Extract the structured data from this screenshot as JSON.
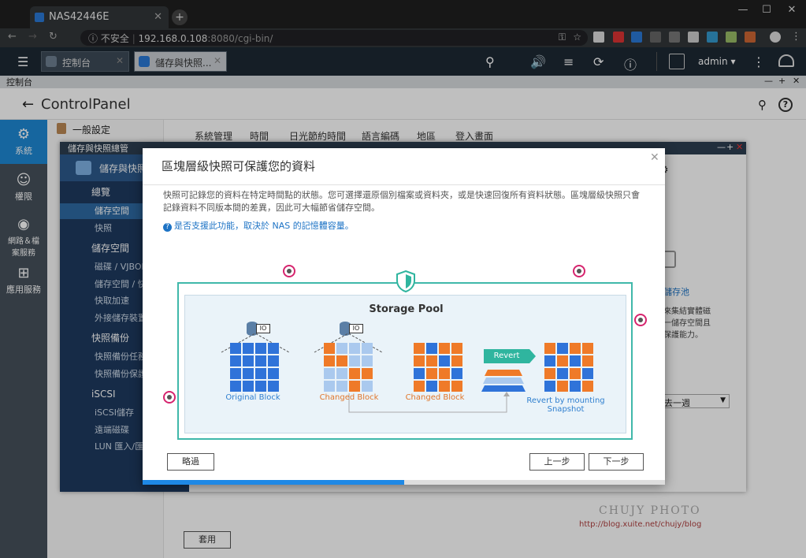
{
  "browser": {
    "tab_title": "NAS42446E",
    "tab_close": "✕",
    "new_tab": "+",
    "window_controls": [
      "—",
      "☐",
      "✕"
    ],
    "nav": [
      "←",
      "→",
      "↻"
    ],
    "security_icon": "ⓘ",
    "security_label": "不安全",
    "url_host": "192.168.0.108",
    "url_rest": ":8080/cgi-bin/",
    "key_icon": "⚿",
    "star_icon": "☆",
    "menu_icon": "⋮"
  },
  "qts_bar": {
    "menu_icon": "☰",
    "tabs": [
      {
        "label": "控制台",
        "close": "✕"
      },
      {
        "label": "儲存與快照...",
        "close": "✕"
      }
    ],
    "icons": [
      "⚲",
      "🔊",
      "≡",
      "⟳",
      "ⓘ"
    ],
    "user": "admin",
    "user_caret": "▾",
    "more": "⋮"
  },
  "control_bar": {
    "title": "控制台",
    "controls": [
      "—",
      "+",
      "✕"
    ]
  },
  "control_panel": {
    "back": "←",
    "title": "ControlPanel",
    "search": "⚲",
    "help": "?",
    "sidebar": [
      {
        "icon": "⚙",
        "label": "系統"
      },
      {
        "icon": "☺",
        "label": "權限"
      },
      {
        "icon": "◉",
        "label": "網路＆檔案服務"
      },
      {
        "icon": "⊞",
        "label": "應用服務"
      }
    ],
    "menu_first": "一般設定",
    "subtabs": [
      "系統管理",
      "時間",
      "日光節約時間",
      "語言編碼",
      "地區",
      "登入畫面"
    ],
    "apply_label": "套用"
  },
  "storage_window": {
    "bar_title": "儲存與快照總管",
    "bar_controls": [
      "—",
      "+",
      "✕"
    ],
    "app_title": "儲存與快照",
    "menu": [
      {
        "label": "總覽",
        "group": true
      },
      {
        "label": "儲存空間",
        "group": false,
        "selected": true
      },
      {
        "label": "快照",
        "group": false
      },
      {
        "label": "儲存空間",
        "group": true
      },
      {
        "label": "磁碟 / VJBOD",
        "group": false
      },
      {
        "label": "儲存空間 / 快",
        "group": false
      },
      {
        "label": "快取加速",
        "group": false
      },
      {
        "label": "外接儲存裝置",
        "group": false
      },
      {
        "label": "快照備份",
        "group": true
      },
      {
        "label": "快照備份任務",
        "group": false
      },
      {
        "label": "快照備份保護",
        "group": false
      },
      {
        "label": "iSCSI",
        "group": true
      },
      {
        "label": "iSCSI儲存",
        "group": false
      },
      {
        "label": "遠端磁碟",
        "group": false
      },
      {
        "label": "LUN 匯入/匯",
        "group": false
      }
    ],
    "right_link": "儲存池",
    "right_text": [
      "來集結實體磁",
      "一儲存空間且",
      "保護能力。"
    ],
    "dropdown_value": "去一週",
    "dropdown_caret": "▼"
  },
  "dialog": {
    "title": "區塊層級快照可保護您的資料",
    "close": "✕",
    "description": "快照可記錄您的資料在特定時間點的狀態。您可選擇還原個別檔案或資料夾，或是快速回復所有資料狀態。區塊層級快照只會記錄資料不同版本間的差異，因此可大幅節省儲存空間。",
    "note_icon": "?",
    "note": "是否支援此功能，取決於 NAS 的記憶體容量。",
    "diagram": {
      "pool_title": "Storage Pool",
      "disk_label": "IO",
      "captions": [
        "Original Block",
        "Changed Block",
        "Changed Block",
        "Revert by mounting Snapshot"
      ],
      "revert_label": "Revert"
    },
    "skip_button": "略過",
    "prev_button": "上一步",
    "next_button": "下一步",
    "progress": 0.5
  },
  "watermark": {
    "line1": "CHUJY PHOTO",
    "line2": "http://blog.xuite.net/chujy/blog"
  }
}
